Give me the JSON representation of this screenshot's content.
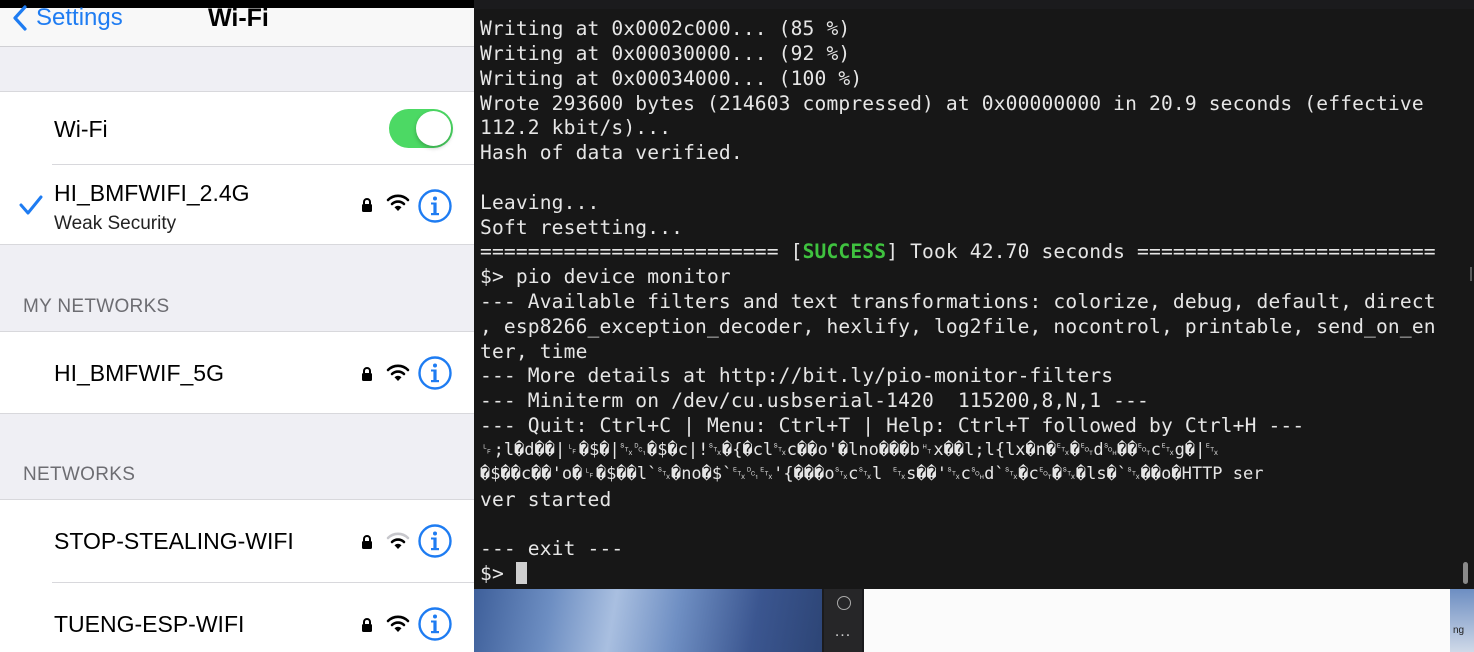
{
  "ios": {
    "back_label": "Settings",
    "title": "Wi-Fi",
    "wifi_toggle_label": "Wi-Fi",
    "wifi_toggle_on": true,
    "connected_network": {
      "name": "HI_BMFWIFI_2.4G",
      "subtitle": "Weak Security",
      "locked": true
    },
    "my_networks_header": "MY NETWORKS",
    "my_networks": [
      {
        "name": "HI_BMFWIF_5G",
        "locked": true
      }
    ],
    "networks_header": "NETWORKS",
    "networks": [
      {
        "name": "STOP-STEALING-WIFI",
        "locked": true
      },
      {
        "name": "TUENG-ESP-WIFI",
        "locked": true
      }
    ],
    "accent_color": "#1e7cf2",
    "toggle_color": "#4cd964"
  },
  "terminal": {
    "lines": [
      "Writing at 0x0002c000... (85 %)",
      "Writing at 0x00030000... (92 %)",
      "Writing at 0x00034000... (100 %)",
      "Wrote 293600 bytes (214603 compressed) at 0x00000000 in 20.9 seconds (effective",
      "112.2 kbit/s)...",
      "Hash of data verified.",
      "",
      "Leaving...",
      "Soft resetting..."
    ],
    "success_line": {
      "left": "========================= [",
      "status": "SUCCESS",
      "right": "] Took 42.70 seconds ========================="
    },
    "lines_after": [
      "$> pio device monitor",
      "--- Available filters and text transformations: colorize, debug, default, direct",
      ", esp8266_exception_decoder, hexlify, log2file, nocontrol, printable, send_on_en",
      "ter, time",
      "--- More details at http://bit.ly/pio-monitor-filters",
      "--- Miniterm on /dev/cu.usbserial-1420  115200,8,N,1 ---",
      "--- Quit: Ctrl+C | Menu: Ctrl+T | Help: Ctrl+T followed by Ctrl+H ---",
      "␊;l�d��|␊�$�|␂␑�$�c|!␂�{�cl␂c��o'�lno���b␉x��l;l{lx�n�␃�␄d␁��␄c␃g�|␃",
      "�$��c��'o�␊�$��l`␂�no�$`␃␑␃'{���o␂c␂l ␃s��'␂c␁d`␂�c␄�␂�ls�`␂��o�HTTP ser",
      "ver started",
      "",
      "--- exit ---"
    ],
    "prompt": "$> ",
    "success_color": "#3fc23f"
  },
  "desktop": {
    "dock_dots": "...",
    "edge_label": "ng"
  }
}
